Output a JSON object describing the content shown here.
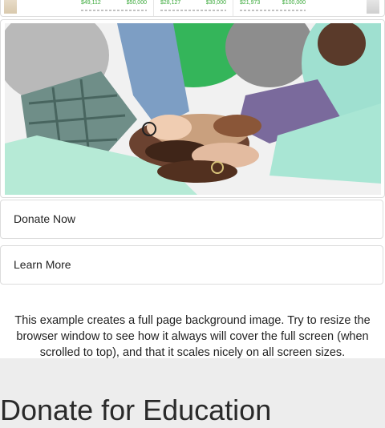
{
  "campaign_strip": {
    "campaigns": [
      {
        "raised": "$49,112",
        "goal": "$50,000"
      },
      {
        "raised": "$28,127",
        "goal": "$30,000"
      },
      {
        "raised": "$21,973",
        "goal": "$100,000"
      }
    ]
  },
  "hero_image": {
    "alt": "Group of people stacking hands together",
    "icon": "stacked-hands-photo"
  },
  "buttons": {
    "donate_label": "Donate Now",
    "learn_label": "Learn More"
  },
  "description": "This example creates a full page background image. Try to resize the browser window to see how it always will cover the full screen (when scrolled to top), and that it scales nicely on all screen sizes.",
  "section": {
    "title": "Donate for Education"
  },
  "colors": {
    "accent_green": "#3aa93a",
    "border": "#dcdcdc",
    "section_bg": "#ededed"
  }
}
